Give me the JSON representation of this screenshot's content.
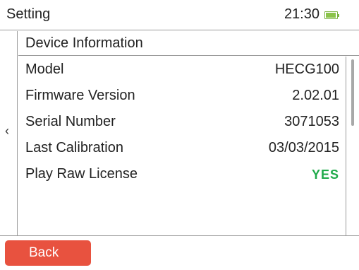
{
  "header": {
    "title": "Setting",
    "time": "21:30",
    "battery_icon": "battery-icon",
    "battery_level": 0.9,
    "battery_color": "#8bc34a"
  },
  "nav": {
    "back_arrow": "‹"
  },
  "section": {
    "title": "Device Information"
  },
  "items": [
    {
      "label": "Model",
      "value": "HECG100"
    },
    {
      "label": "Firmware Version",
      "value": "2.02.01"
    },
    {
      "label": "Serial Number",
      "value": "3071053"
    },
    {
      "label": "Last Calibration",
      "value": "03/03/2015"
    },
    {
      "label": "Play Raw License",
      "value": "YES",
      "value_color": "#1faa4a"
    }
  ],
  "footer": {
    "back_label": "Back",
    "back_color": "#e8523f"
  }
}
